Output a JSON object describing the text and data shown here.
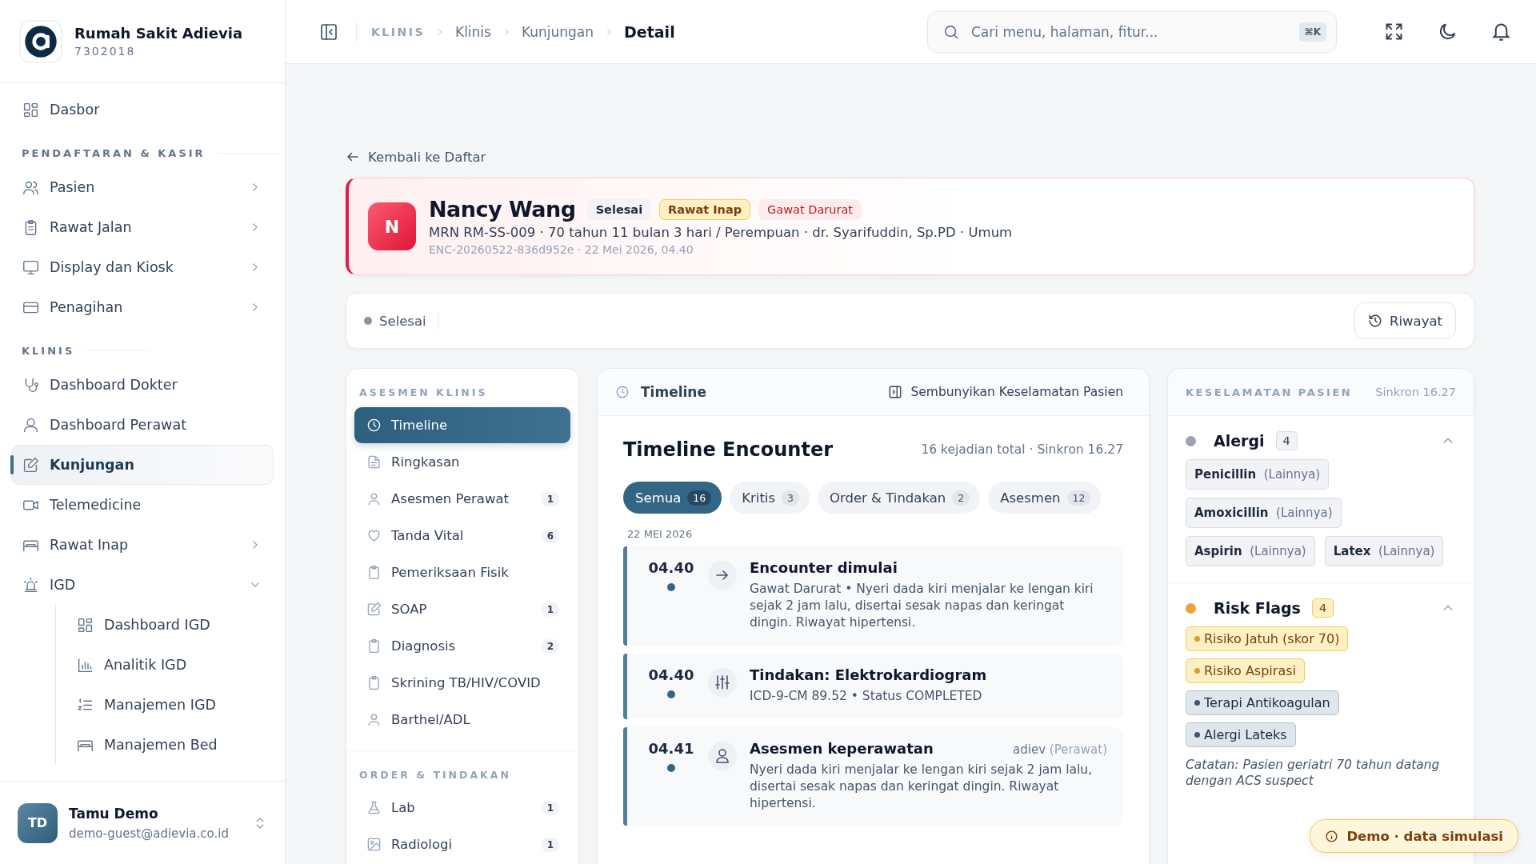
{
  "app": {
    "name": "Rumah Sakit Adievia",
    "code": "7302018"
  },
  "sidebar": {
    "items": [
      {
        "kind": "item",
        "label": "Dasbor",
        "selected": false
      },
      {
        "kind": "section",
        "label": "PENDAFTARAN & KASIR"
      },
      {
        "kind": "item",
        "label": "Pasien",
        "selected": false,
        "expandable": true
      },
      {
        "kind": "item",
        "label": "Rawat Jalan",
        "selected": false,
        "expandable": true
      },
      {
        "kind": "item",
        "label": "Display dan Kiosk",
        "selected": false,
        "expandable": true
      },
      {
        "kind": "item",
        "label": "Penagihan",
        "selected": false,
        "expandable": true
      },
      {
        "kind": "section",
        "label": "KLINIS"
      },
      {
        "kind": "item",
        "label": "Dashboard Dokter",
        "selected": false
      },
      {
        "kind": "item",
        "label": "Dashboard Perawat",
        "selected": false
      },
      {
        "kind": "item",
        "label": "Kunjungan",
        "selected": true
      },
      {
        "kind": "item",
        "label": "Telemedicine",
        "selected": false
      },
      {
        "kind": "item",
        "label": "Rawat Inap",
        "selected": false,
        "expandable": true
      },
      {
        "kind": "item",
        "label": "IGD",
        "selected": false,
        "expandable": true,
        "expanded": true,
        "children": [
          {
            "label": "Dashboard IGD",
            "selected": false
          },
          {
            "label": "Analitik IGD",
            "selected": false
          },
          {
            "label": "Manajemen IGD",
            "selected": false
          },
          {
            "label": "Manajemen Bed",
            "selected": false
          }
        ]
      }
    ]
  },
  "user": {
    "initials": "TD",
    "name": "Tamu Demo",
    "email": "demo-guest@adievia.co.id"
  },
  "header": {
    "breadcrumb": [
      "KLINIS",
      "Klinis",
      "Kunjungan",
      "Detail"
    ],
    "search": {
      "placeholder": "Cari menu, halaman, fitur...",
      "shortcut": "⌘K"
    }
  },
  "back_link": "Kembali ke Daftar",
  "patient": {
    "initial": "N",
    "name": "Nancy Wang",
    "badges": [
      {
        "label": "Selesai",
        "kind": "neutral"
      },
      {
        "label": "Rawat Inap",
        "kind": "warning"
      },
      {
        "label": "Gawat Darurat",
        "kind": "danger"
      }
    ],
    "info": "MRN RM-SS-009 · 70 tahun 11 bulan 3 hari / Perempuan · dr. Syarifuddin, Sp.PD · Umum",
    "encounter": "ENC-20260522-836d952e · 22 Mei 2026, 04.40"
  },
  "status_bar": {
    "status": "Selesai",
    "button": "Riwayat"
  },
  "assessment_nav": {
    "sections": [
      {
        "title": "ASESMEN KLINIS",
        "items": [
          {
            "label": "Timeline",
            "selected": true
          },
          {
            "label": "Ringkasan",
            "selected": false
          },
          {
            "label": "Asesmen Perawat",
            "count": "1",
            "selected": false
          },
          {
            "label": "Tanda Vital",
            "count": "6",
            "selected": false
          },
          {
            "label": "Pemeriksaan Fisik",
            "selected": false
          },
          {
            "label": "SOAP",
            "count": "1",
            "selected": false
          },
          {
            "label": "Diagnosis",
            "count": "2",
            "selected": false
          },
          {
            "label": "Skrining TB/HIV/COVID",
            "selected": false
          },
          {
            "label": "Barthel/ADL",
            "selected": false
          }
        ]
      },
      {
        "title": "ORDER & TINDAKAN",
        "items": [
          {
            "label": "Lab",
            "count": "1",
            "selected": false
          },
          {
            "label": "Radiologi",
            "count": "1",
            "selected": false
          }
        ]
      }
    ]
  },
  "timeline": {
    "tab": "Timeline",
    "hide_button": "Sembunyikan Keselamatan Pasien",
    "heading": "Timeline Encounter",
    "summary": "16 kejadian total · Sinkron 16.27",
    "filters": [
      {
        "label": "Semua",
        "count": "16",
        "selected": true
      },
      {
        "label": "Kritis",
        "count": "3",
        "selected": false
      },
      {
        "label": "Order & Tindakan",
        "count": "2",
        "selected": false
      },
      {
        "label": "Asesmen",
        "count": "12",
        "selected": false
      }
    ],
    "date": "22 MEI 2026",
    "events": [
      {
        "kind": "start",
        "time": "04.40",
        "title": "Encounter dimulai",
        "text": "Gawat Darurat • Nyeri dada kiri menjalar ke lengan kiri sejak 2 jam lalu, disertai sesak napas dan keringat dingin. Riwayat hipertensi."
      },
      {
        "kind": "procedure",
        "time": "04.40",
        "title": "Tindakan: Elektrokardiogram",
        "text": "ICD-9-CM 89.52 • Status COMPLETED"
      },
      {
        "kind": "assessment",
        "time": "04.41",
        "title": "Asesmen keperawatan",
        "author": "adiev",
        "role": "(Perawat)",
        "text": "Nyeri dada kiri menjalar ke lengan kiri sejak 2 jam lalu, disertai sesak napas dan keringat dingin. Riwayat hipertensi."
      }
    ]
  },
  "safety": {
    "title": "KESELAMATAN PASIEN",
    "sync": "Sinkron 16.27",
    "allergies": {
      "title": "Alergi",
      "count": "4",
      "color": "#9ca3af",
      "expanded": true,
      "items": [
        {
          "name": "Penicillin",
          "category": "(Lainnya)"
        },
        {
          "name": "Amoxicillin",
          "category": "(Lainnya)"
        },
        {
          "name": "Aspirin",
          "category": "(Lainnya)"
        },
        {
          "name": "Latex",
          "category": "(Lainnya)"
        }
      ]
    },
    "risk_flags": {
      "title": "Risk Flags",
      "count": "4",
      "color": "#f0a03c",
      "expanded": true,
      "items": [
        {
          "label": "Risiko Jatuh (skor 70)",
          "kind": "warning"
        },
        {
          "label": "Risiko Aspirasi",
          "kind": "warning"
        },
        {
          "label": "Terapi Antikoagulan",
          "kind": "info"
        },
        {
          "label": "Alergi Lateks",
          "kind": "info"
        }
      ]
    },
    "note": "Catatan: Pasien geriatri 70 tahun datang dengan ACS suspect"
  },
  "toast": "Demo · data simulasi"
}
